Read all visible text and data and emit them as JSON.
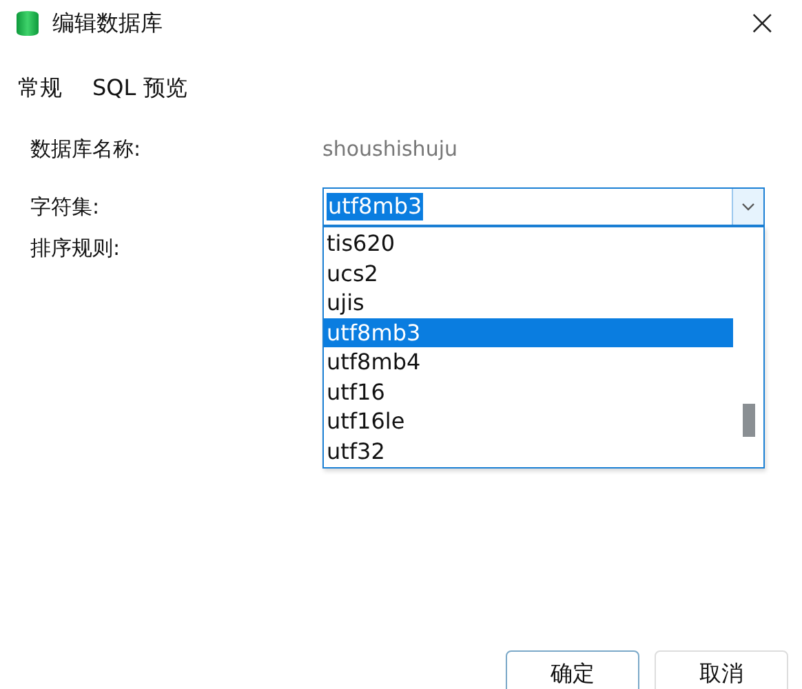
{
  "window": {
    "title": "编辑数据库",
    "close": "×"
  },
  "tabs": [
    {
      "label": "常规"
    },
    {
      "label": "SQL 预览"
    }
  ],
  "form": {
    "name_label": "数据库名称:",
    "name_value": "shoushishuju",
    "charset_label": "字符集:",
    "charset_value": "utf8mb3",
    "collation_label": "排序规则:"
  },
  "dropdown": {
    "options": [
      {
        "label": "tis620",
        "selected": false
      },
      {
        "label": "ucs2",
        "selected": false
      },
      {
        "label": "ujis",
        "selected": false
      },
      {
        "label": "utf8mb3",
        "selected": true
      },
      {
        "label": "utf8mb4",
        "selected": false
      },
      {
        "label": "utf16",
        "selected": false
      },
      {
        "label": "utf16le",
        "selected": false
      },
      {
        "label": "utf32",
        "selected": false
      }
    ]
  },
  "buttons": [
    {
      "label": "确定",
      "kind": "primary"
    },
    {
      "label": "取消",
      "kind": "secondary"
    }
  ]
}
